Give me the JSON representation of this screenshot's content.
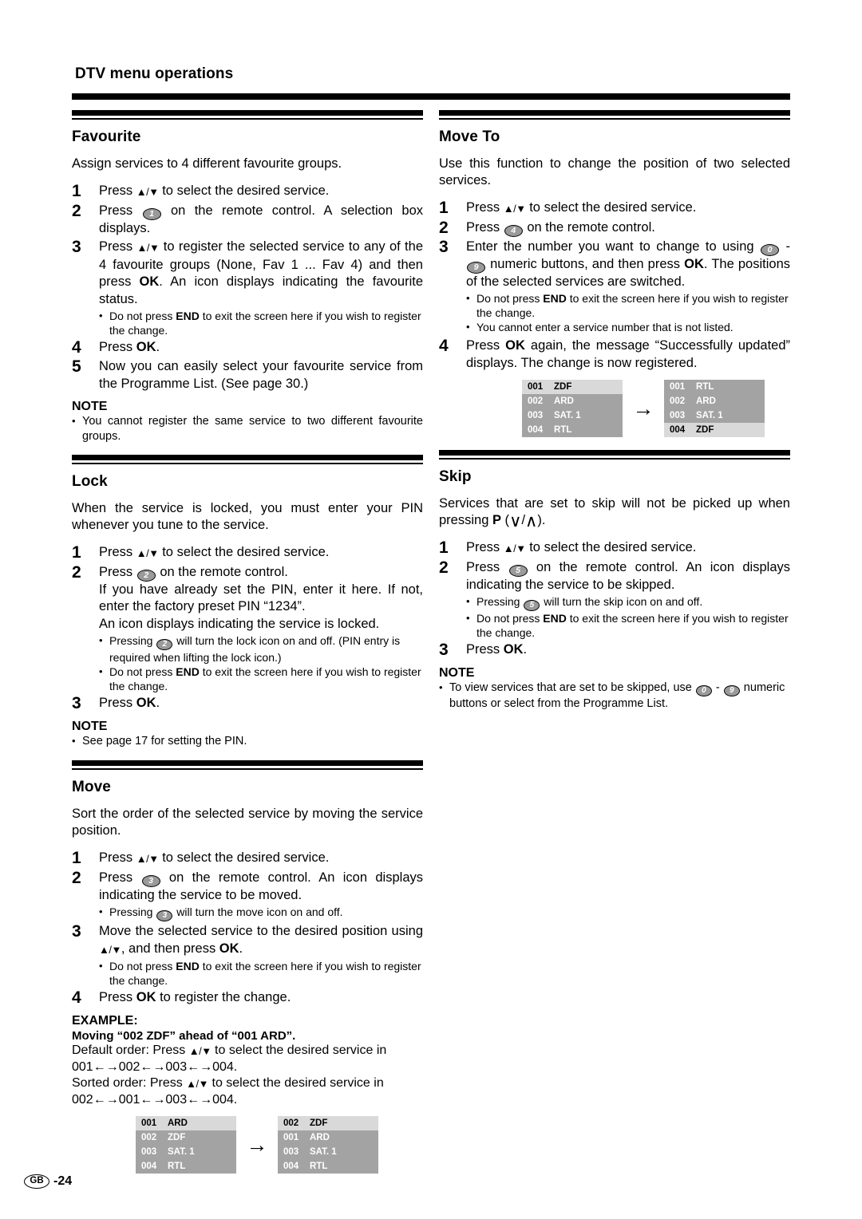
{
  "document": {
    "title": "DTV menu operations",
    "footer": {
      "region_code": "GB",
      "page": "-24"
    }
  },
  "left_column": {
    "sections": [
      {
        "id": "favourite",
        "heading": "Favourite",
        "intro": "Assign services to 4 different favourite groups.",
        "steps": [
          {
            "num": "1",
            "text_parts": [
              "Press ",
              "UPDOWN",
              " to select the desired service."
            ]
          },
          {
            "num": "2",
            "text_parts": [
              "Press ",
              "BTN1",
              " on the remote control. A selection box displays."
            ]
          },
          {
            "num": "3",
            "text_parts": [
              "Press ",
              "UPDOWN",
              " to register the selected service to any of the 4 favourite groups (None, Fav 1 ... Fav 4) and then press ",
              "OK",
              ". An icon displays indicating the favourite status."
            ],
            "bullets": [
              "Do not press END to exit the screen here if you wish to register the change."
            ]
          },
          {
            "num": "4",
            "text_parts": [
              "Press ",
              "OK",
              "."
            ]
          },
          {
            "num": "5",
            "text_parts": [
              "Now you can easily select your favourite service from the Programme List. (See page 30.)"
            ]
          }
        ],
        "note_label": "NOTE",
        "notes": [
          "You cannot register the same service to two different favourite groups."
        ]
      },
      {
        "id": "lock",
        "heading": "Lock",
        "intro": "When the service is locked, you must enter your PIN whenever you tune to the service.",
        "steps": [
          {
            "num": "1",
            "text_parts": [
              "Press ",
              "UPDOWN",
              " to select the desired service."
            ]
          },
          {
            "num": "2",
            "text_parts": [
              "Press ",
              "BTN2",
              " on the remote control."
            ],
            "extra_lines": [
              "If you have already set the PIN, enter it here. If not, enter the factory preset PIN “1234”.",
              "An icon displays indicating the service is locked."
            ],
            "bullets": [
              "Pressing BTN2 will turn the lock icon on and off. (PIN entry is required when lifting the lock icon.)",
              "Do not press END to exit the screen here if you wish to register the change."
            ]
          },
          {
            "num": "3",
            "text_parts": [
              "Press ",
              "OK",
              "."
            ]
          }
        ],
        "note_label": "NOTE",
        "notes": [
          "See page 17 for setting the PIN."
        ]
      },
      {
        "id": "move",
        "heading": "Move",
        "intro": "Sort the order of the selected service by moving the service position.",
        "steps": [
          {
            "num": "1",
            "text_parts": [
              "Press ",
              "UPDOWN",
              " to select the desired service."
            ]
          },
          {
            "num": "2",
            "text_parts": [
              "Press ",
              "BTN3",
              " on the remote control. An icon displays indicating the service to be moved."
            ],
            "bullets": [
              "Pressing BTN3 will turn the move icon on and off."
            ]
          },
          {
            "num": "3",
            "text_parts": [
              "Move the selected service to the desired position using ",
              "UPDOWN",
              ", and then press ",
              "OK",
              "."
            ],
            "bullets": [
              "Do not press END to exit the screen here if you wish to register the change."
            ]
          },
          {
            "num": "4",
            "text_parts": [
              "Press ",
              "OK",
              " to register the change."
            ]
          }
        ],
        "example": {
          "label": "EXAMPLE:",
          "subtitle": "Moving “002 ZDF” ahead of “001 ARD”.",
          "lines": [
            "Default order: Press ▲/▼ to select the desired service in",
            "001←→002←→003←→004.",
            "Sorted order: Press ▲/▼ to select the desired service in",
            "002←→001←→003←→004."
          ],
          "table_before": {
            "rows": [
              {
                "num": "001",
                "name": "ARD",
                "highlight": true
              },
              {
                "num": "002",
                "name": "ZDF",
                "highlight": false
              },
              {
                "num": "003",
                "name": "SAT. 1",
                "highlight": false
              },
              {
                "num": "004",
                "name": "RTL",
                "highlight": false
              }
            ]
          },
          "arrow": "→",
          "table_after": {
            "rows": [
              {
                "num": "002",
                "name": "ZDF",
                "highlight": true
              },
              {
                "num": "001",
                "name": "ARD",
                "highlight": false
              },
              {
                "num": "003",
                "name": "SAT. 1",
                "highlight": false
              },
              {
                "num": "004",
                "name": "RTL",
                "highlight": false
              }
            ]
          }
        }
      }
    ]
  },
  "right_column": {
    "sections": [
      {
        "id": "move-to",
        "heading": "Move To",
        "intro": "Use this function to change the position of two selected services.",
        "steps": [
          {
            "num": "1",
            "text_parts": [
              "Press ",
              "UPDOWN",
              " to select the desired service."
            ]
          },
          {
            "num": "2",
            "text_parts": [
              "Press ",
              "BTN4",
              " on the remote control."
            ]
          },
          {
            "num": "3",
            "text_parts": [
              "Enter the number you want to change to using ",
              "BTN0",
              " - ",
              "BTN9",
              " numeric buttons, and then press ",
              "OK",
              ". The positions of the selected services are switched."
            ],
            "bullets": [
              "Do not press END to exit the screen here if you wish to register the change.",
              "You cannot enter a service number that is not listed."
            ]
          },
          {
            "num": "4",
            "text_parts": [
              "Press ",
              "OK",
              " again, the message “Successfully updated” displays. The change is now registered."
            ]
          }
        ],
        "table_before": {
          "rows": [
            {
              "num": "001",
              "name": "ZDF",
              "highlight": true
            },
            {
              "num": "002",
              "name": "ARD",
              "highlight": false
            },
            {
              "num": "003",
              "name": "SAT. 1",
              "highlight": false
            },
            {
              "num": "004",
              "name": "RTL",
              "highlight": false
            }
          ]
        },
        "arrow": "→",
        "table_after": {
          "rows": [
            {
              "num": "001",
              "name": "RTL",
              "highlight": false
            },
            {
              "num": "002",
              "name": "ARD",
              "highlight": false
            },
            {
              "num": "003",
              "name": "SAT. 1",
              "highlight": false
            },
            {
              "num": "004",
              "name": "ZDF",
              "highlight": true
            }
          ]
        }
      },
      {
        "id": "skip",
        "heading": "Skip",
        "intro_a": "Services that are set to skip will not be picked up when pressing ",
        "intro_p": "P",
        "intro_b": ").",
        "steps": [
          {
            "num": "1",
            "text_parts": [
              "Press ",
              "UPDOWN",
              " to select the desired service."
            ]
          },
          {
            "num": "2",
            "text_parts": [
              "Press ",
              "BTN5",
              " on the remote control. An icon displays indicating the service to be skipped."
            ],
            "bullets": [
              "Pressing BTN5 will turn the skip icon on and off.",
              "Do not press END to exit the screen here if you wish to register the change."
            ]
          },
          {
            "num": "3",
            "text_parts": [
              "Press ",
              "OK",
              "."
            ]
          }
        ],
        "note_label": "NOTE",
        "notes": [
          "To view services that are set to be skipped, use BTN0 - BTN9 numeric buttons or select from the Programme List."
        ]
      }
    ]
  },
  "labels": {
    "ok": "OK",
    "end": "END",
    "up_arrow": "▲",
    "down_arrow": "▼",
    "slash": "/",
    "btn0": "0",
    "btn1": "1",
    "btn2": "2",
    "btn3": "3",
    "btn4": "4",
    "btn5": "5",
    "btn9": "9",
    "p_down": "∨",
    "p_up": "∧"
  },
  "colors": {
    "table_bg": "#a3a3a3",
    "table_highlight_bg": "#d9d9d9",
    "button_fill": "#9a9a9a",
    "text": "#000000"
  }
}
